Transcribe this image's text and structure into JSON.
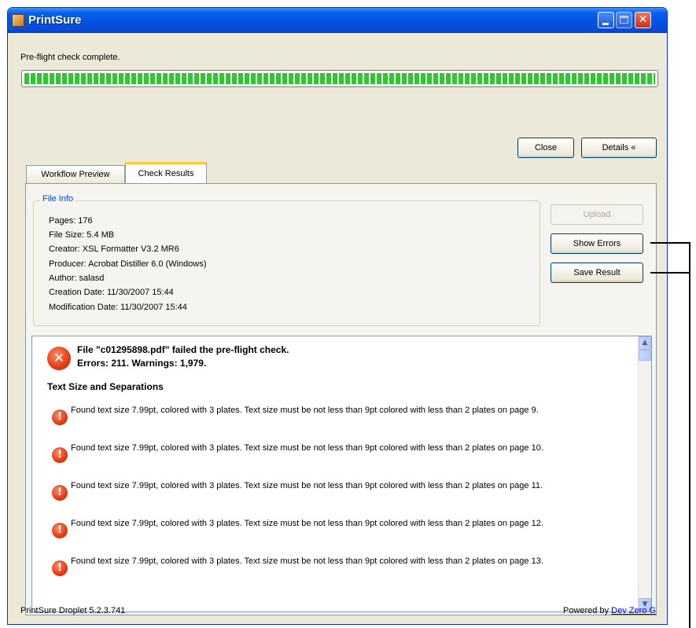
{
  "window": {
    "title": "PrintSure"
  },
  "status": {
    "message": "Pre-flight check complete.",
    "progress_percent": 100
  },
  "buttons": {
    "close": "Close",
    "details": "Details «",
    "upload": "Upload",
    "show_errors": "Show Errors",
    "save_result": "Save Result"
  },
  "tabs": [
    {
      "label": "Workflow Preview",
      "active": false
    },
    {
      "label": "Check Results",
      "active": true
    }
  ],
  "file_info": {
    "legend": "File Info",
    "lines": [
      "Pages: 176",
      "File Size: 5.4 MB",
      "Creator: XSL Formatter V3.2 MR6",
      "Producer: Acrobat Distiller 6.0 (Windows)",
      "Author: salasd",
      "Creation Date: 11/30/2007 15:44",
      "Modification Date: 11/30/2007 15:44"
    ]
  },
  "results": {
    "fail_line1": "File \"c01295898.pdf\" failed the pre-flight check.",
    "fail_line2": "Errors: 211. Warnings: 1,979.",
    "section": "Text Size and Separations",
    "issues": [
      "Found text size 7.99pt, colored with 3 plates. Text size must be not less than 9pt colored with less than 2 plates on page 9.",
      "Found text size 7.99pt, colored with 3 plates. Text size must be not less than 9pt colored with less than 2 plates on page 10.",
      "Found text size 7.99pt, colored with 3 plates. Text size must be not less than 9pt colored with less than 2 plates on page 11.",
      "Found text size 7.99pt, colored with 3 plates. Text size must be not less than 9pt colored with less than 2 plates on page 12.",
      "Found text size 7.99pt, colored with 3 plates. Text size must be not less than 9pt colored with less than 2 plates on page 13."
    ]
  },
  "footer": {
    "version": "PrintSure Droplet 5.2.3.741",
    "powered_by": "Powered by",
    "link": "Dev Zero G"
  },
  "colors": {
    "titlebar": "#0054e3",
    "progress": "#2bc92b",
    "error": "#e23b12",
    "legend": "#0046d5"
  }
}
